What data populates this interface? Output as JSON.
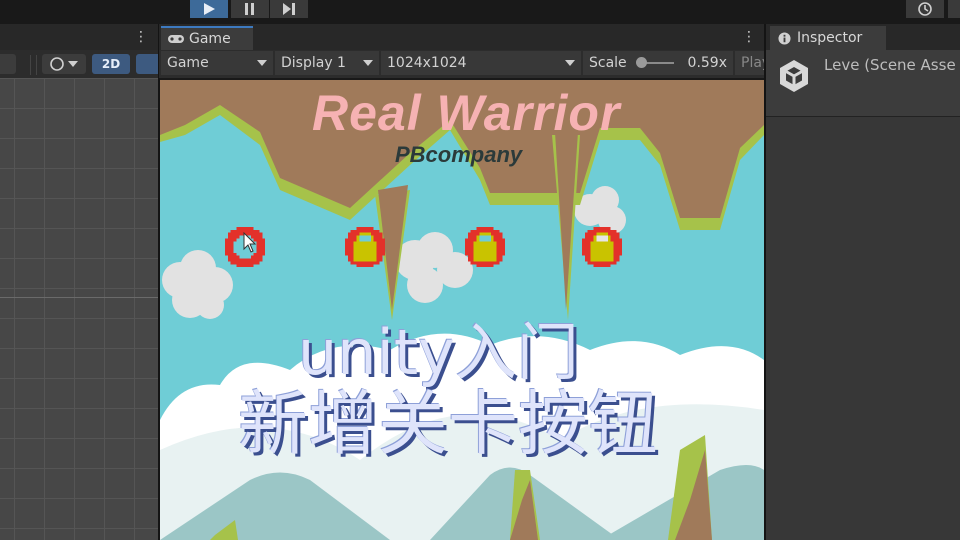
{
  "toolbar": {
    "play_icon": "play-icon",
    "pause_icon": "pause-icon",
    "step_icon": "step-icon",
    "history_icon": "history-icon"
  },
  "scene": {
    "mode_2d_label": "2D",
    "menu_glyph": "⋮"
  },
  "game": {
    "tab_label": "Game",
    "tab_icon": "gamepad-icon",
    "menu_glyph": "⋮",
    "view_select": "Game",
    "display_select": "Display 1",
    "resolution_select": "1024x1024",
    "scale_label": "Scale",
    "scale_value": "0.59x",
    "scale_fraction": 0.05,
    "play_mode_label": "Play",
    "title": "Real Warrior",
    "subtitle": "PBcompany",
    "level_buttons": [
      {
        "state": "unlocked",
        "icon": "circle-button-icon"
      },
      {
        "state": "locked",
        "icon": "lock-icon"
      },
      {
        "state": "locked",
        "icon": "lock-icon"
      },
      {
        "state": "locked",
        "icon": "lock-icon"
      }
    ],
    "overlay_line1": "unity入门",
    "overlay_line2": "新增关卡按钮",
    "colors": {
      "sky": "#6fcdd6",
      "earth": "#a07a5a",
      "grass": "#a6c24a",
      "title": "#f6b2b3",
      "button_red": "#e3312a",
      "lock_yellow": "#c9c300"
    }
  },
  "inspector": {
    "tab_label": "Inspector",
    "tab_icon": "info-icon",
    "asset_title": "Leve (Scene Asse",
    "asset_icon": "unity-logo-icon"
  }
}
